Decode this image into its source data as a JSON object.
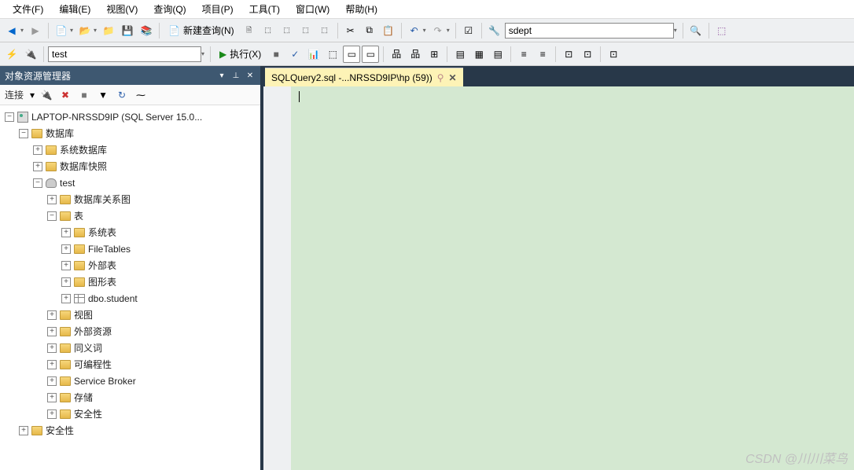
{
  "menu": {
    "file": "文件(F)",
    "edit": "编辑(E)",
    "view": "视图(V)",
    "query": "查询(Q)",
    "project": "项目(P)",
    "tools": "工具(T)",
    "window": "窗口(W)",
    "help": "帮助(H)"
  },
  "toolbar1": {
    "new_query": "新建查询(N)",
    "search_value": "sdept"
  },
  "toolbar2": {
    "db_value": "test",
    "execute": "执行(X)"
  },
  "panel": {
    "title": "对象资源管理器",
    "connect": "连接"
  },
  "tree": {
    "server": "LAPTOP-NRSSD9IP (SQL Server 15.0...",
    "databases": "数据库",
    "sys_databases": "系统数据库",
    "db_snapshots": "数据库快照",
    "test": "test",
    "db_diagrams": "数据库关系图",
    "tables": "表",
    "sys_tables": "系统表",
    "filetables": "FileTables",
    "external_tables": "外部表",
    "graph_tables": "图形表",
    "dbo_student": "dbo.student",
    "views": "视图",
    "external_resources": "外部资源",
    "synonyms": "同义词",
    "programmability": "可编程性",
    "service_broker": "Service Broker",
    "storage": "存储",
    "security_db": "安全性",
    "security_server": "安全性"
  },
  "tab": {
    "title": "SQLQuery2.sql -...NRSSD9IP\\hp (59))"
  },
  "watermark": "CSDN @川川菜鸟"
}
